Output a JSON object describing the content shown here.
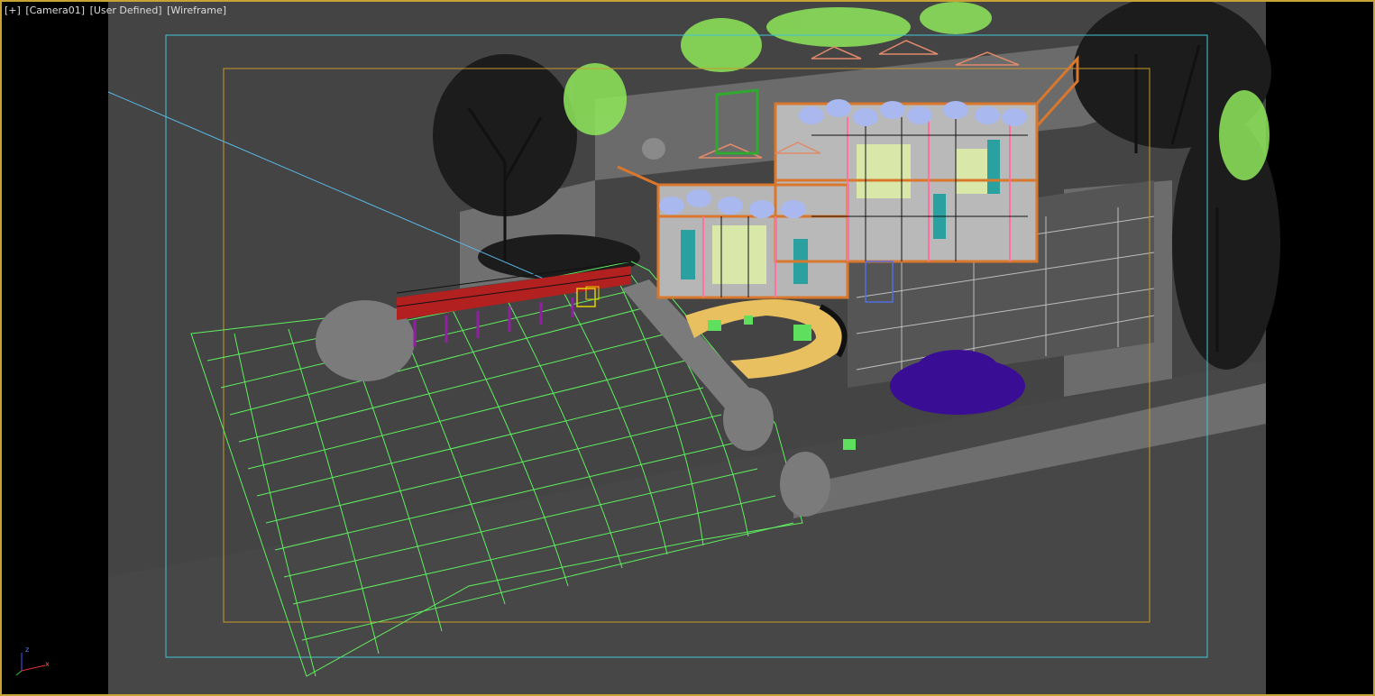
{
  "viewport": {
    "menus": [
      {
        "id": "plus",
        "label": "[+]"
      },
      {
        "id": "camera",
        "label": "[Camera01]"
      },
      {
        "id": "shading-mode",
        "label": "[User Defined]"
      },
      {
        "id": "display-mode",
        "label": "[Wireframe]"
      }
    ],
    "axis_labels": {
      "z": "z",
      "x": "x"
    }
  },
  "colors": {
    "frame_border": "#c7a335",
    "safe_frame_outer": "#3fc6d6",
    "safe_frame_inner": "#c99a2a",
    "viewport_bg": "#444444",
    "terrain_wire": "#5ef05e",
    "car": "#3a0d95",
    "vegetation": "#8fe85a",
    "building_frame": "#d9772d",
    "umbrella": "#aab8f0"
  },
  "icons": {
    "axis_gizmo": "axis-tripod-icon"
  }
}
